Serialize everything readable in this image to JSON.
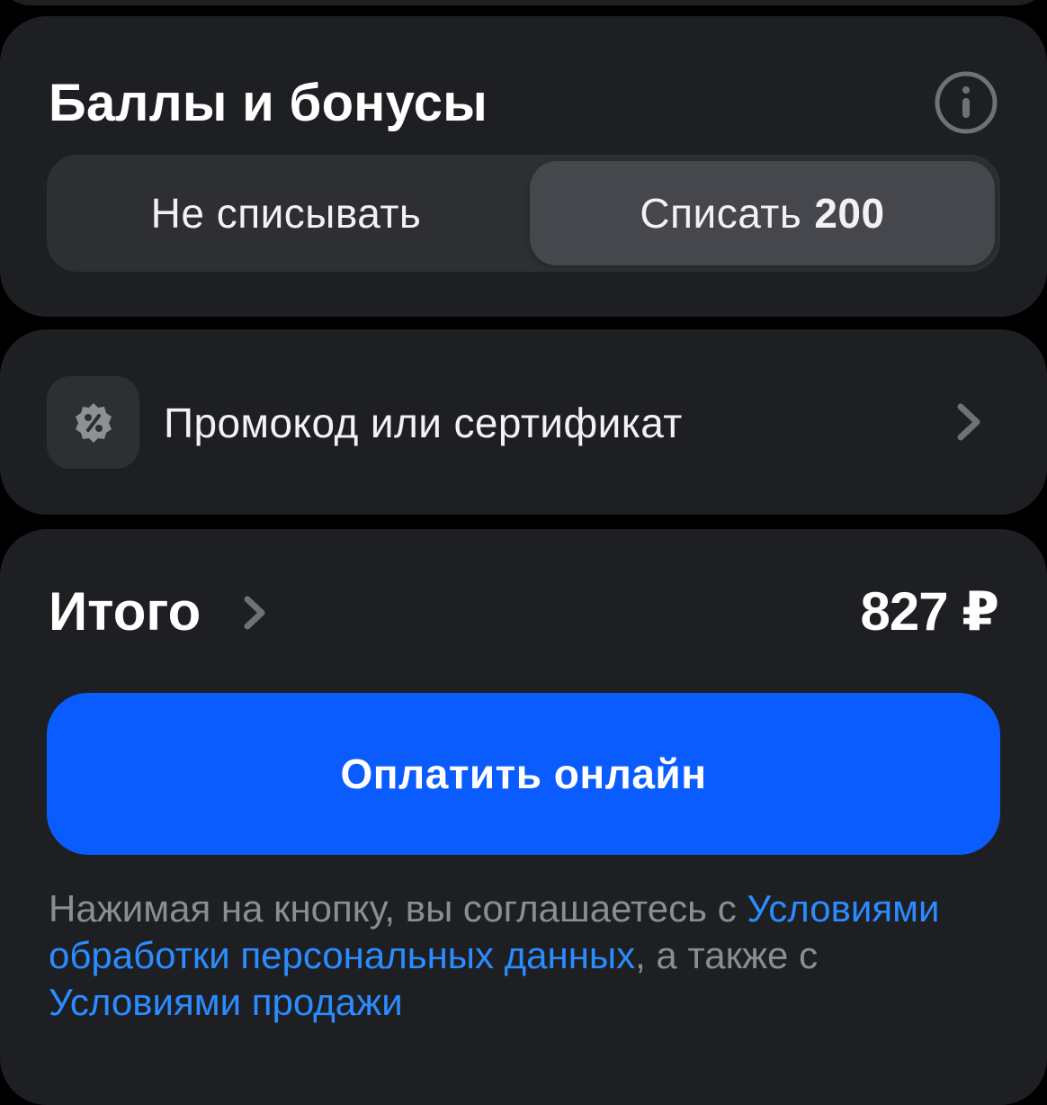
{
  "bonus": {
    "title": "Баллы и бонусы",
    "options": {
      "no_spend": "Не списывать",
      "spend_label": "Списать",
      "spend_amount": "200"
    },
    "selected": "spend"
  },
  "promo": {
    "label": "Промокод или сертификат"
  },
  "total": {
    "label": "Итого",
    "amount": "827 ₽"
  },
  "pay_button": {
    "label": "Оплатить онлайн"
  },
  "legal": {
    "prefix": "Нажимая на кнопку, вы соглашаетесь с ",
    "link1": "Условиями обработки персональных данных",
    "middle": ", а также с ",
    "link2": "Условиями продажи"
  },
  "colors": {
    "background": "#000000",
    "card": "#1d1f23",
    "segment_track": "#2d2f33",
    "segment_selected": "#45474c",
    "accent": "#0a5cff",
    "link": "#2b8cff",
    "muted_text": "#8b8d92"
  },
  "icons": {
    "info": "info-circle-icon",
    "promo": "percent-badge-icon",
    "chevron": "chevron-right-icon"
  }
}
